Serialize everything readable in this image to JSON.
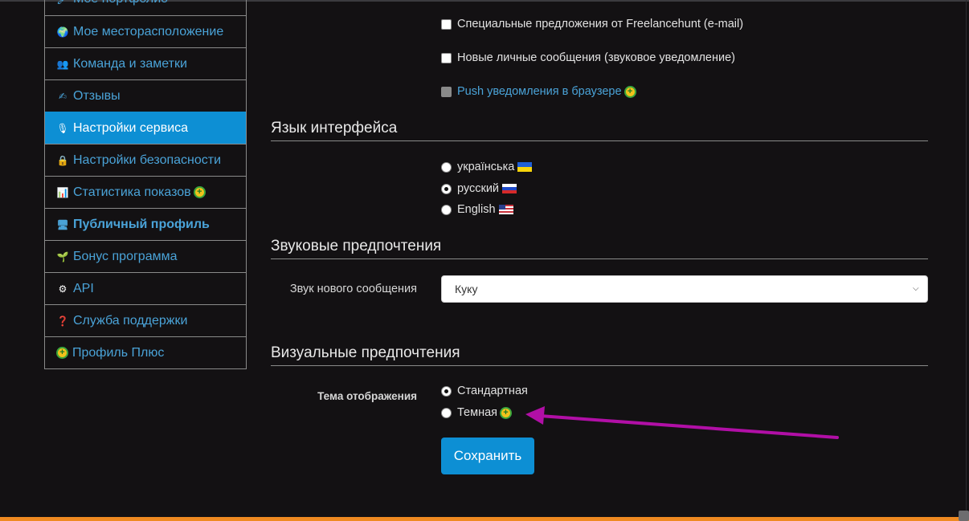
{
  "sidebar": {
    "items": [
      {
        "label": "Мое портфолио",
        "icon": "portfolio-icon"
      },
      {
        "label": "Мое месторасположение",
        "icon": "globe-icon"
      },
      {
        "label": "Команда и заметки",
        "icon": "team-icon"
      },
      {
        "label": "Отзывы",
        "icon": "reviews-icon"
      },
      {
        "label": "Настройки сервиса",
        "icon": "settings-icon",
        "active": true
      },
      {
        "label": "Настройки безопасности",
        "icon": "lock-icon"
      },
      {
        "label": "Статистика показов",
        "icon": "stats-icon",
        "plus": true
      },
      {
        "label": "Публичный профиль",
        "icon": "monitor-icon",
        "bold": true
      },
      {
        "label": "Бонус программа",
        "icon": "sprout-icon"
      },
      {
        "label": "API",
        "icon": "gear-icon"
      },
      {
        "label": "Служба поддержки",
        "icon": "help-icon"
      },
      {
        "label": "Профиль Плюс",
        "icon": "plus-badge-icon"
      }
    ]
  },
  "notifications": {
    "special_offers": {
      "label": "Специальные предложения от Freelancehunt (e-mail)",
      "checked": false
    },
    "new_messages": {
      "label": "Новые личные сообщения (звуковое уведомление)",
      "checked": false
    },
    "push": {
      "label": "Push уведомления в браузере",
      "checked": false,
      "disabled": true
    }
  },
  "language": {
    "title": "Язык интерфейса",
    "options": [
      {
        "label": "українська",
        "flag": "ua-flag",
        "checked": false
      },
      {
        "label": "русский",
        "flag": "ru-flag",
        "checked": true
      },
      {
        "label": "English",
        "flag": "us-flag",
        "checked": false
      }
    ]
  },
  "sound": {
    "title": "Звуковые предпочтения",
    "field_label": "Звук нового сообщения",
    "selected": "Куку"
  },
  "visual": {
    "title": "Визуальные предпочтения",
    "field_label": "Тема отображения",
    "options": [
      {
        "label": "Стандартная",
        "checked": true
      },
      {
        "label": "Темная",
        "checked": false,
        "plus": true
      }
    ]
  },
  "save_label": "Сохранить",
  "colors": {
    "accent": "#0d8fd4",
    "link": "#4aa3d8",
    "background": "#131113",
    "annotation_arrow": "#b10fa6",
    "bottom_bar": "#ef8a21"
  }
}
